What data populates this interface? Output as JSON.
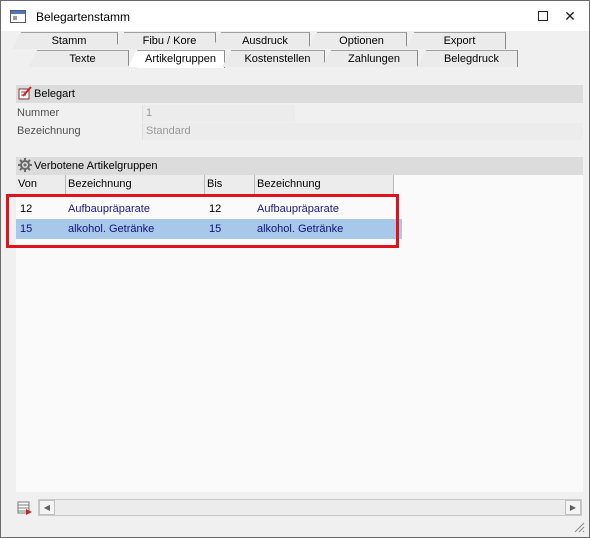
{
  "window": {
    "title": "Belegartenstamm",
    "maximize_label": "",
    "close_label": "✕"
  },
  "tabs_row1": [
    {
      "label": "Stamm"
    },
    {
      "label": "Fibu / Kore"
    },
    {
      "label": "Ausdruck"
    },
    {
      "label": "Optionen"
    },
    {
      "label": "Export"
    }
  ],
  "tabs_row2": [
    {
      "label": "Texte"
    },
    {
      "label": "Artikelgruppen",
      "active": true
    },
    {
      "label": "Kostenstellen"
    },
    {
      "label": "Zahlungen"
    },
    {
      "label": "Belegdruck"
    }
  ],
  "belegart": {
    "title": "Belegart",
    "icon": "pencil-edit-icon",
    "nummer_label": "Nummer",
    "nummer_value": "1",
    "bezeichnung_label": "Bezeichnung",
    "bezeichnung_value": "Standard"
  },
  "verbotene": {
    "title": "Verbotene Artikelgruppen",
    "icon": "gear-icon",
    "columns": [
      "Von",
      "Bezeichnung",
      "Bis",
      "Bezeichnung"
    ],
    "rows": [
      {
        "von": "12",
        "von_bez": "Aufbaupräparate",
        "bis": "12",
        "bis_bez": "Aufbaupräparate",
        "selected": false
      },
      {
        "von": "15",
        "von_bez": "alkohol. Getränke",
        "bis": "15",
        "bis_bez": "alkohol. Getränke",
        "selected": true
      }
    ]
  },
  "colors": {
    "highlight_border": "#e0121b",
    "selected_row": "#a8c8ea",
    "section_header": "#dcdcdc"
  }
}
